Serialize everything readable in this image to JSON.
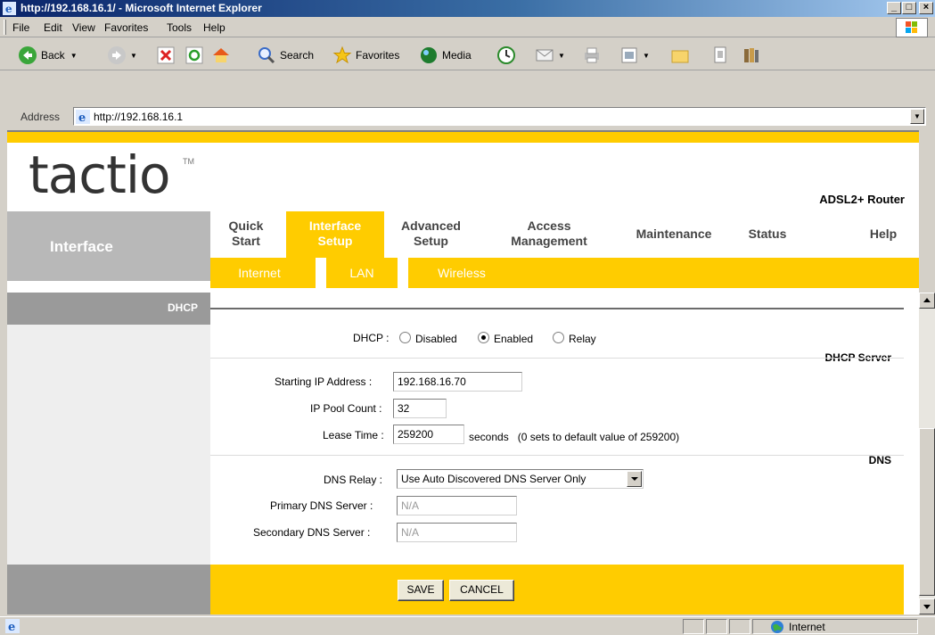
{
  "window": {
    "title": "http://192.168.16.1/ - Microsoft Internet Explorer",
    "minimize": "_",
    "maximize": "□",
    "close": "×"
  },
  "menu": [
    "File",
    "Edit",
    "View",
    "Favorites",
    "Tools",
    "Help"
  ],
  "toolbar": {
    "back": "Back",
    "search": "Search",
    "favorites": "Favorites",
    "media": "Media"
  },
  "address": {
    "label": "Address",
    "url": "http://192.168.16.1"
  },
  "router": {
    "logo": "tactio",
    "tm": "TM",
    "product": "ADSL2+ Router",
    "section": "Interface",
    "nav": [
      {
        "line1": "Quick",
        "line2": "Start"
      },
      {
        "line1": "Interface",
        "line2": "Setup"
      },
      {
        "line1": "Advanced",
        "line2": "Setup"
      },
      {
        "line1": "Access",
        "line2": "Management"
      },
      {
        "line1": "Maintenance",
        "line2": ""
      },
      {
        "line1": "Status",
        "line2": ""
      },
      {
        "line1": "Help",
        "line2": ""
      }
    ],
    "subnav": [
      "Internet",
      "LAN",
      "Wireless"
    ]
  },
  "form": {
    "section_title": "DHCP",
    "dhcp_server_label": "DHCP Server",
    "dns_label": "DNS",
    "dhcp_label": "DHCP :",
    "dhcp_options": [
      "Disabled",
      "Enabled",
      "Relay"
    ],
    "dhcp_selected": "Enabled",
    "start_ip_label": "Starting IP Address :",
    "start_ip": "192.168.16.70",
    "pool_count_label": "IP Pool Count :",
    "pool_count": "32",
    "lease_time_label": "Lease Time :",
    "lease_time": "259200",
    "lease_suffix": "seconds   (0 sets to default value of 259200)",
    "dns_relay_label": "DNS Relay :",
    "dns_relay": "Use Auto Discovered DNS Server Only",
    "primary_dns_label": "Primary DNS Server :",
    "primary_dns": "N/A",
    "secondary_dns_label": "Secondary DNS Server :",
    "secondary_dns": "N/A",
    "save": "SAVE",
    "cancel": "CANCEL"
  },
  "status": {
    "zone": "Internet"
  },
  "colors": {
    "accent": "#ffcc00",
    "nav_gray": "#b8b8b8",
    "titlebar": "#0a246a"
  }
}
